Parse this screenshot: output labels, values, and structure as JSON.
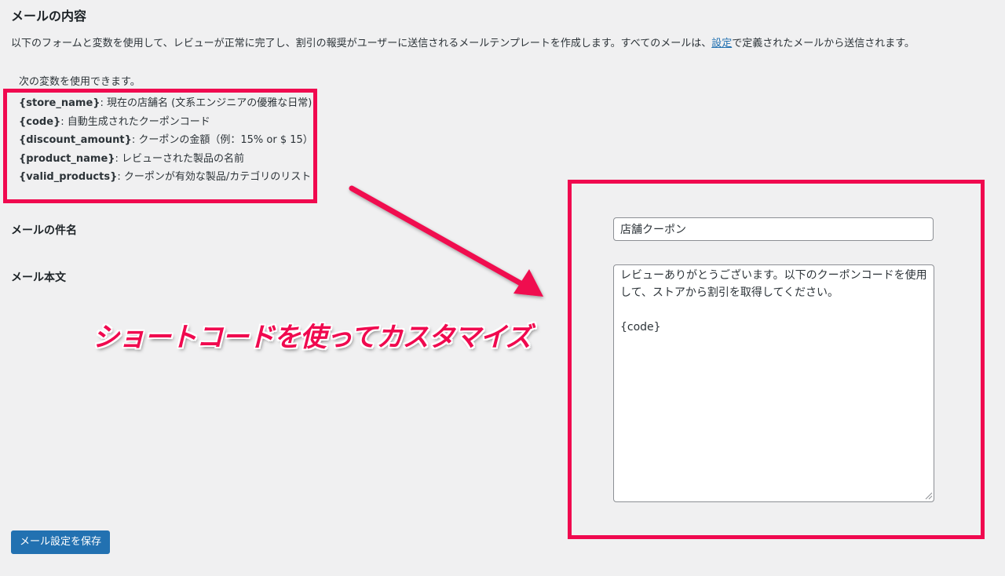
{
  "section": {
    "title": "メールの内容",
    "description_before": "以下のフォームと変数を使用して、レビューが正常に完了し、割引の報奨がユーザーに送信されるメールテンプレートを作成します。すべてのメールは、",
    "description_link": "設定",
    "description_after": "で定義されたメールから送信されます。"
  },
  "variables": {
    "intro": "次の変数を使用できます。",
    "items": [
      {
        "code": "{store_name}",
        "desc": ": 現在の店舗名 (文系エンジニアの優雅な日常)"
      },
      {
        "code": "{code}",
        "desc": ": 自動生成されたクーポンコード"
      },
      {
        "code": "{discount_amount}",
        "desc": ": クーポンの金額（例：15% or $ 15）"
      },
      {
        "code": "{product_name}",
        "desc": ": レビューされた製品の名前"
      },
      {
        "code": "{valid_products}",
        "desc": ": クーポンが有効な製品/カテゴリのリスト"
      }
    ]
  },
  "form": {
    "subject_label": "メールの件名",
    "subject_value": "店舗クーポン",
    "body_label": "メール本文",
    "body_value": "レビューありがとうございます。以下のクーポンコードを使用して、ストアから割引を取得してください。\n\n{code}"
  },
  "annotation": {
    "text": "ショートコードを使ってカスタマイズ",
    "color": "#f0094f"
  },
  "actions": {
    "save_label": "メール設定を保存"
  },
  "colors": {
    "background": "#f0f0f1",
    "primary": "#2271b1",
    "highlight": "#f0094f"
  }
}
